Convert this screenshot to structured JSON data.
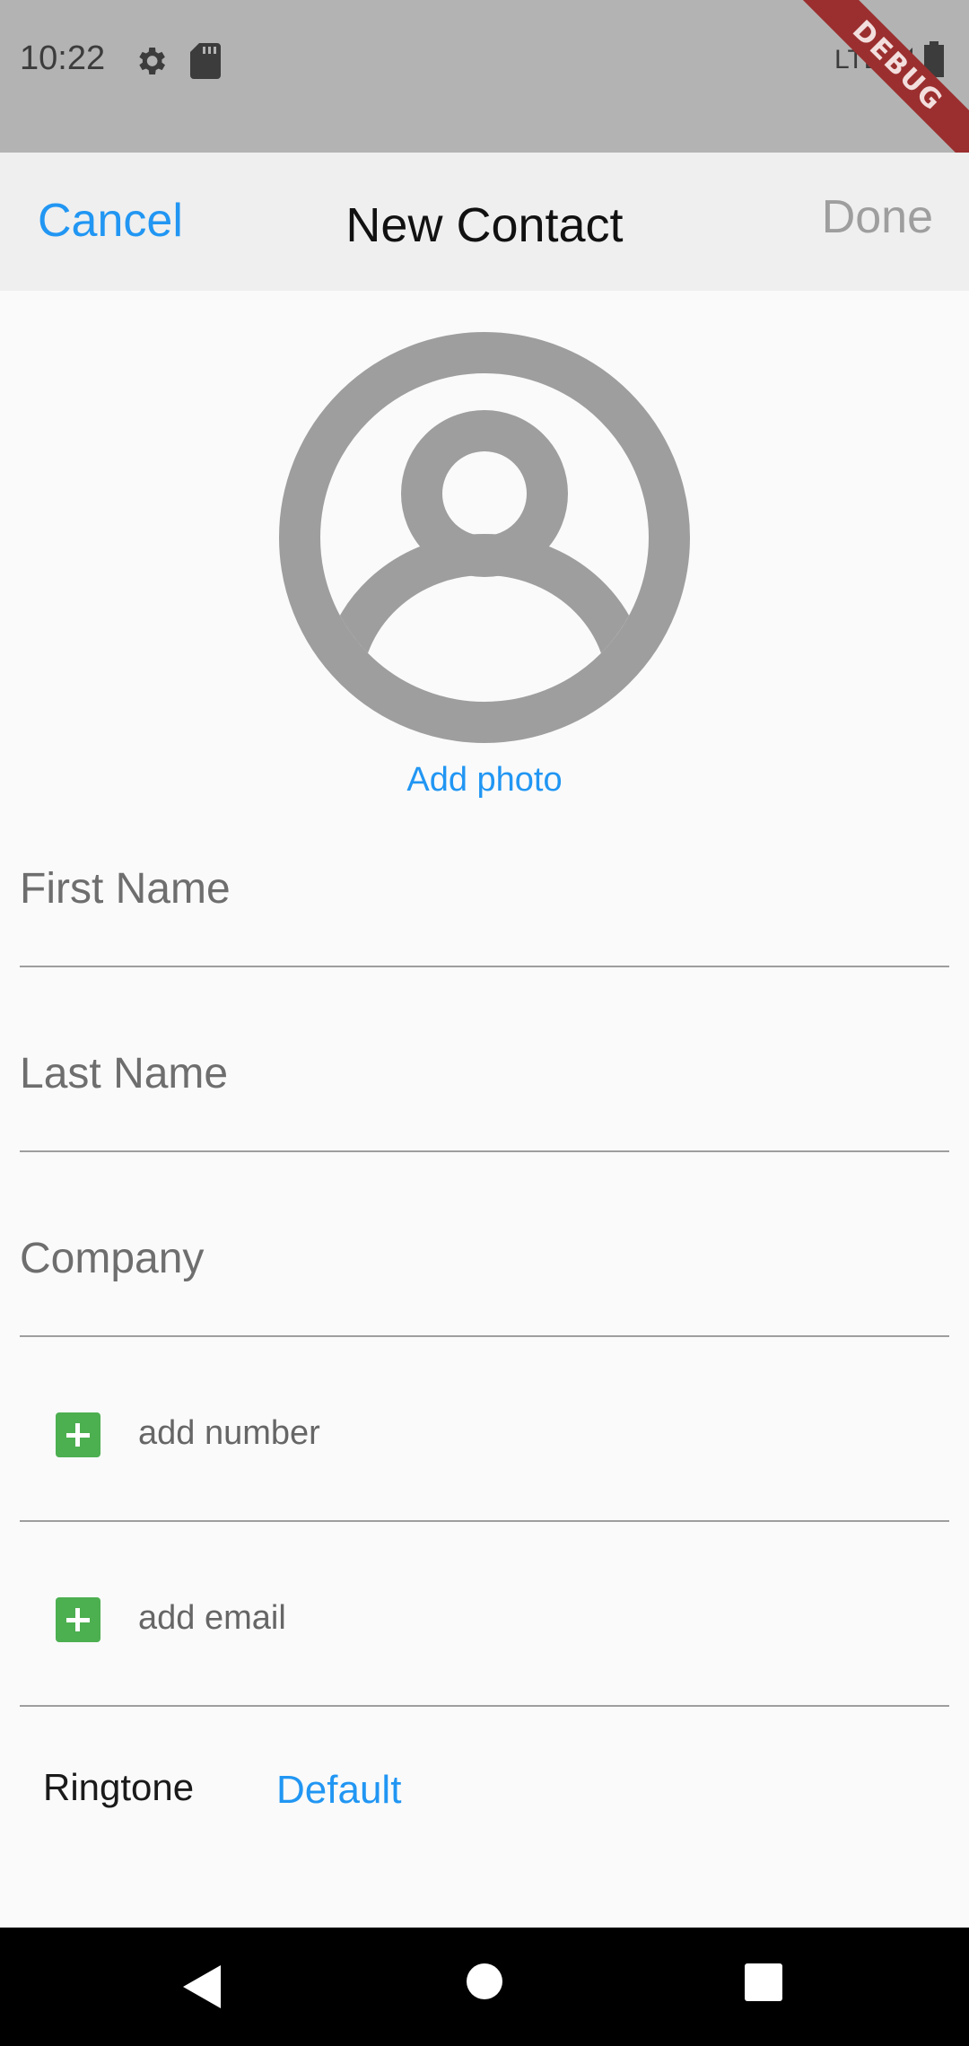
{
  "status_bar": {
    "time": "10:22",
    "network": "LTE",
    "icons": [
      "gear-icon",
      "sd-card-icon",
      "signal-icon",
      "battery-icon"
    ],
    "debug_banner": "DEBUG"
  },
  "nav": {
    "cancel_label": "Cancel",
    "title": "New Contact",
    "done_label": "Done"
  },
  "photo": {
    "icon": "account-circle-icon",
    "add_label": "Add photo"
  },
  "fields": {
    "first_name": {
      "placeholder": "First Name",
      "value": ""
    },
    "last_name": {
      "placeholder": "Last Name",
      "value": ""
    },
    "company": {
      "placeholder": "Company",
      "value": ""
    }
  },
  "add_rows": {
    "number": "add number",
    "email": "add email"
  },
  "ringtone": {
    "label": "Ringtone",
    "value": "Default"
  },
  "system_nav": [
    "back-icon",
    "home-icon",
    "recents-icon"
  ],
  "colors": {
    "accent": "#2196f3",
    "add_green": "#4caf50",
    "status_bar": "#b3b3b3",
    "nav_bar": "#efefef",
    "debug_banner": "#9b2f2f"
  }
}
